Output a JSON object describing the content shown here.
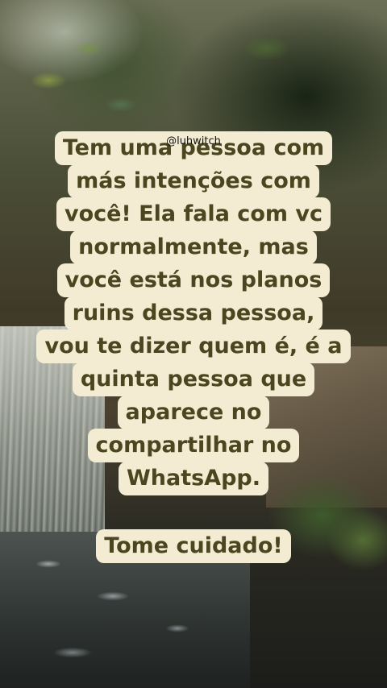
{
  "post": {
    "handle": "@luhwitch",
    "lines": [
      "Tem uma pessoa com",
      "más intenções com",
      "você! Ela fala com vc",
      "normalmente, mas",
      "você está nos planos",
      "ruins dessa pessoa,",
      "vou te dizer quem é, é a",
      "quinta pessoa que",
      "aparece no",
      "compartilhar no",
      "WhatsApp."
    ],
    "warning": "Tome cuidado!"
  },
  "colors": {
    "caption_bg": "#f3ecd2",
    "caption_text": "#4b4620"
  }
}
